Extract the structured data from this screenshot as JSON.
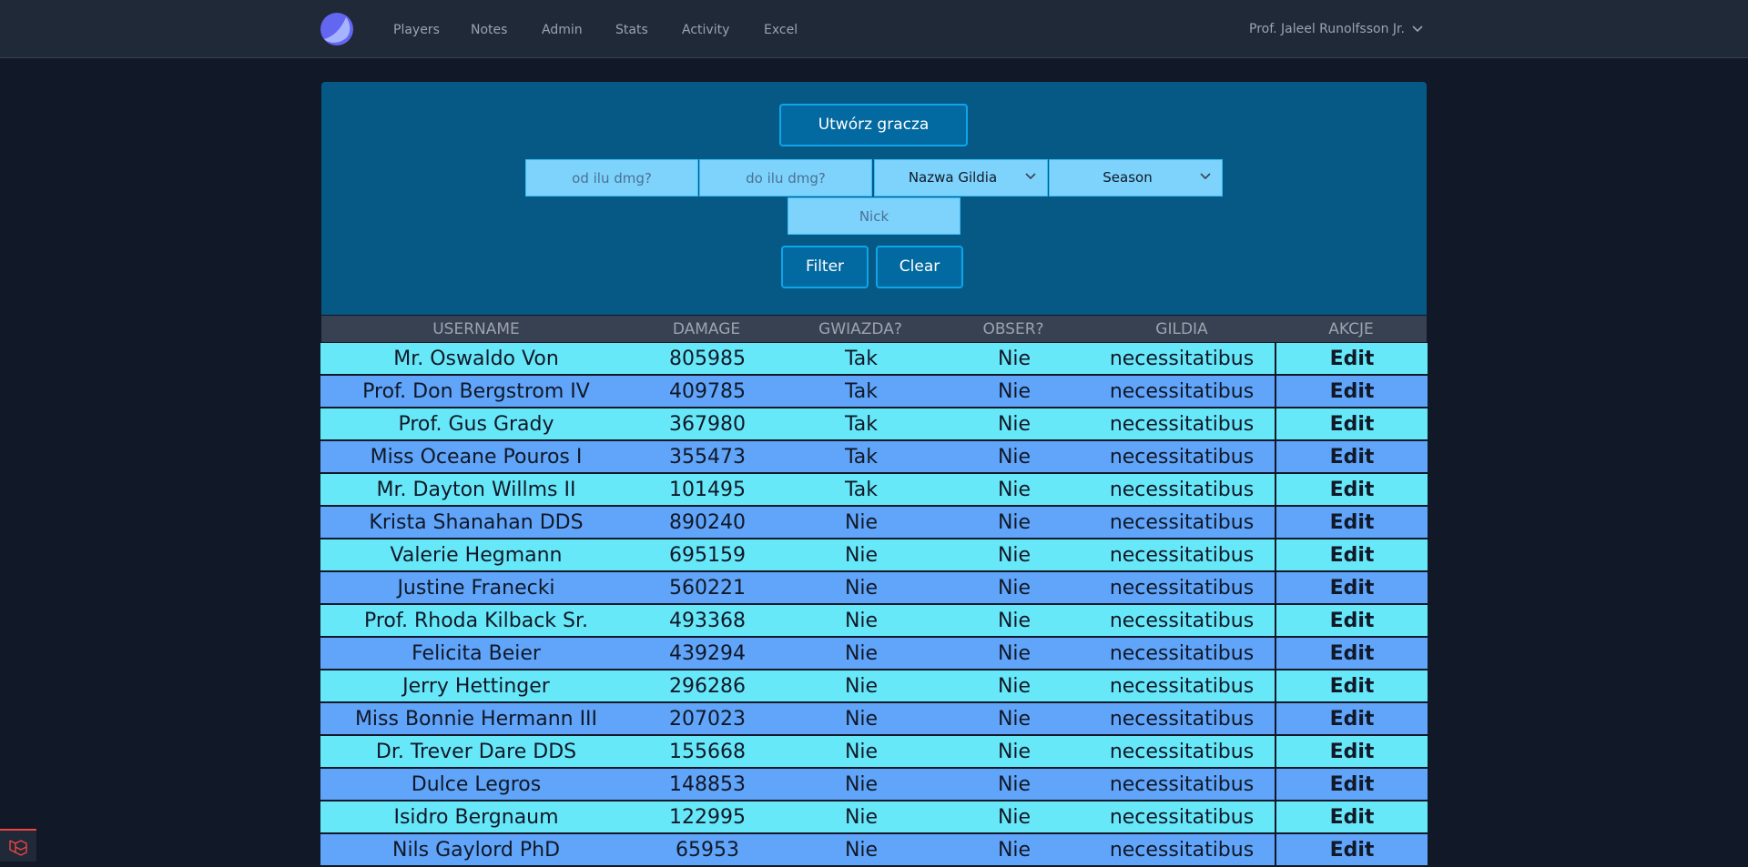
{
  "nav": {
    "logo_icon": "crescent-logo-icon",
    "links": [
      {
        "label": "Players"
      },
      {
        "label": "Notes"
      },
      {
        "label": "Admin"
      },
      {
        "label": "Stats"
      },
      {
        "label": "Activity"
      },
      {
        "label": "Excel"
      }
    ],
    "user_name": "Prof. Jaleel Runolfsson Jr."
  },
  "filters": {
    "create_label": "Utwórz gracza",
    "dmg_from_placeholder": "od ilu dmg?",
    "dmg_to_placeholder": "do ilu dmg?",
    "guild_select_value": "Nazwa Gildia",
    "season_select_value": "Season",
    "nick_placeholder": "Nick",
    "filter_label": "Filter",
    "clear_label": "Clear"
  },
  "table": {
    "headers": [
      "USERNAME",
      "DAMAGE",
      "GWIAZDA?",
      "OBSER?",
      "GILDIA",
      "AKCJE"
    ],
    "edit_label": "Edit",
    "rows": [
      {
        "username": "Mr. Oswaldo Von",
        "damage": "805985",
        "star": "Tak",
        "obser": "Nie",
        "guild": "necessitatibus"
      },
      {
        "username": "Prof. Don Bergstrom IV",
        "damage": "409785",
        "star": "Tak",
        "obser": "Nie",
        "guild": "necessitatibus"
      },
      {
        "username": "Prof. Gus Grady",
        "damage": "367980",
        "star": "Tak",
        "obser": "Nie",
        "guild": "necessitatibus"
      },
      {
        "username": "Miss Oceane Pouros I",
        "damage": "355473",
        "star": "Tak",
        "obser": "Nie",
        "guild": "necessitatibus"
      },
      {
        "username": "Mr. Dayton Willms II",
        "damage": "101495",
        "star": "Tak",
        "obser": "Nie",
        "guild": "necessitatibus"
      },
      {
        "username": "Krista Shanahan DDS",
        "damage": "890240",
        "star": "Nie",
        "obser": "Nie",
        "guild": "necessitatibus"
      },
      {
        "username": "Valerie Hegmann",
        "damage": "695159",
        "star": "Nie",
        "obser": "Nie",
        "guild": "necessitatibus"
      },
      {
        "username": "Justine Franecki",
        "damage": "560221",
        "star": "Nie",
        "obser": "Nie",
        "guild": "necessitatibus"
      },
      {
        "username": "Prof. Rhoda Kilback Sr.",
        "damage": "493368",
        "star": "Nie",
        "obser": "Nie",
        "guild": "necessitatibus"
      },
      {
        "username": "Felicita Beier",
        "damage": "439294",
        "star": "Nie",
        "obser": "Nie",
        "guild": "necessitatibus"
      },
      {
        "username": "Jerry Hettinger",
        "damage": "296286",
        "star": "Nie",
        "obser": "Nie",
        "guild": "necessitatibus"
      },
      {
        "username": "Miss Bonnie Hermann III",
        "damage": "207023",
        "star": "Nie",
        "obser": "Nie",
        "guild": "necessitatibus"
      },
      {
        "username": "Dr. Trever Dare DDS",
        "damage": "155668",
        "star": "Nie",
        "obser": "Nie",
        "guild": "necessitatibus"
      },
      {
        "username": "Dulce Legros",
        "damage": "148853",
        "star": "Nie",
        "obser": "Nie",
        "guild": "necessitatibus"
      },
      {
        "username": "Isidro Bergnaum",
        "damage": "122995",
        "star": "Nie",
        "obser": "Nie",
        "guild": "necessitatibus"
      },
      {
        "username": "Nils Gaylord PhD",
        "damage": "65953",
        "star": "Nie",
        "obser": "Nie",
        "guild": "necessitatibus"
      }
    ]
  },
  "colors": {
    "row_odd": "#67e8f9",
    "row_even": "#60a5fa",
    "panel": "#075985",
    "background": "#111827"
  },
  "footer": {
    "badge_icon": "laravel-logo-icon"
  }
}
